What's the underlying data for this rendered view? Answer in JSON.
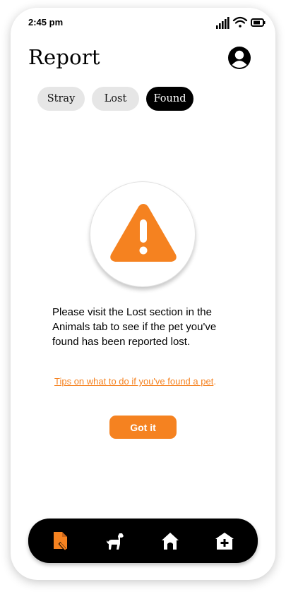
{
  "status": {
    "time": "2:45 pm"
  },
  "header": {
    "title": "Report"
  },
  "tabs": [
    {
      "label": "Stray",
      "active": false
    },
    {
      "label": "Lost",
      "active": false
    },
    {
      "label": "Found",
      "active": true
    }
  ],
  "message": "Please visit the Lost section in the Animals tab to see if the pet you've found has been reported lost.",
  "tips": {
    "link_text": "Tips on what to do if you've found a pet",
    "trailing": "."
  },
  "button": {
    "label": "Got it"
  },
  "nav": {
    "items": [
      "report-icon",
      "dog-icon",
      "home-icon",
      "shelter-icon"
    ]
  },
  "colors": {
    "accent": "#f58220",
    "dark": "#000000",
    "tab_inactive": "#e6e6e6"
  }
}
